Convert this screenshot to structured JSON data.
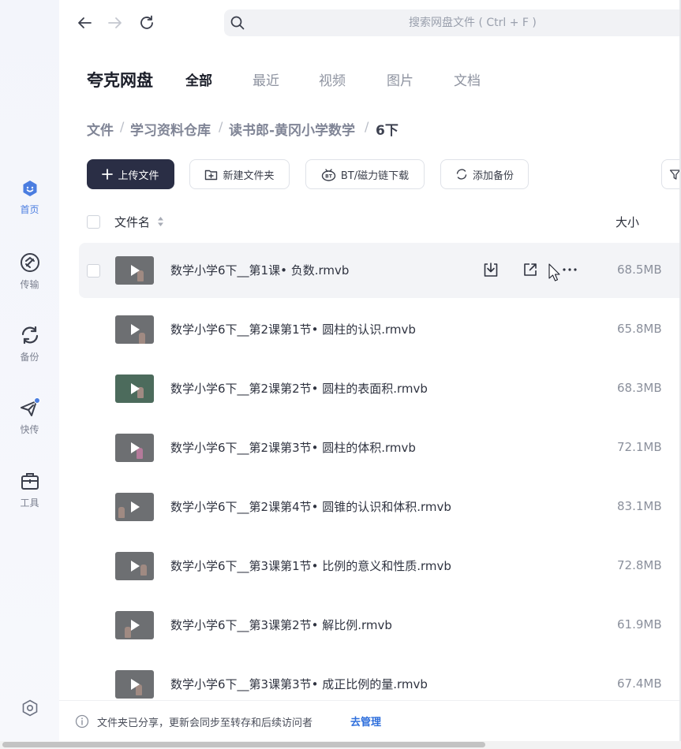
{
  "search": {
    "placeholder": "搜索网盘文件 ( Ctrl + F )"
  },
  "sidebar": {
    "items": [
      {
        "label": "首页",
        "icon": "home-face-icon"
      },
      {
        "label": "传输",
        "icon": "transfer-icon"
      },
      {
        "label": "备份",
        "icon": "backup-icon"
      },
      {
        "label": "快传",
        "icon": "send-plane-icon"
      },
      {
        "label": "工具",
        "icon": "toolbox-icon"
      }
    ]
  },
  "header": {
    "brand": "夸克网盘",
    "tabs": [
      "全部",
      "最近",
      "视频",
      "图片",
      "文档"
    ]
  },
  "breadcrumb": [
    "文件",
    "学习资料仓库",
    "读书郎-黄冈小学数学",
    "6下"
  ],
  "toolbar": {
    "upload": "上传文件",
    "new_folder": "新建文件夹",
    "bt_download": "BT/磁力链下载",
    "add_backup": "添加备份"
  },
  "list": {
    "col_name": "文件名",
    "col_size": "大小",
    "files": [
      {
        "name": "数学小学6下__第1课• 负数.rmvb",
        "size": "68.5MB"
      },
      {
        "name": "数学小学6下__第2课第1节• 圆柱的认识.rmvb",
        "size": "65.8MB"
      },
      {
        "name": "数学小学6下__第2课第2节• 圆柱的表面积.rmvb",
        "size": "68.3MB"
      },
      {
        "name": "数学小学6下__第2课第3节• 圆柱的体积.rmvb",
        "size": "72.1MB"
      },
      {
        "name": "数学小学6下__第2课第4节• 圆锥的认识和体积.rmvb",
        "size": "83.1MB"
      },
      {
        "name": "数学小学6下__第3课第1节• 比例的意义和性质.rmvb",
        "size": "72.8MB"
      },
      {
        "name": "数学小学6下__第3课第2节• 解比例.rmvb",
        "size": "61.9MB"
      },
      {
        "name": "数学小学6下__第3课第3节• 成正比例的量.rmvb",
        "size": "67.4MB"
      }
    ]
  },
  "footer": {
    "message": "文件夹已分享，更新会同步至转存和后续访问者",
    "manage": "去管理"
  },
  "colors": {
    "accent": "#4a7de0",
    "primary_button": "#2a2e45",
    "link": "#2f6fdc"
  }
}
